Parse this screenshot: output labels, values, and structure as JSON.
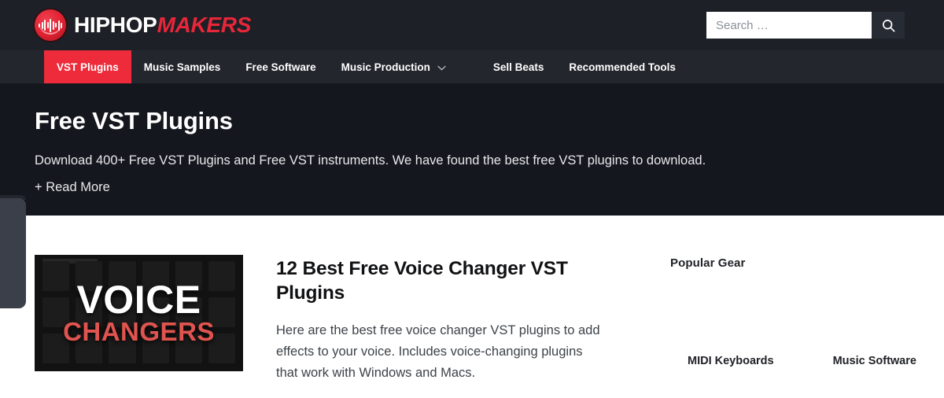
{
  "brand": {
    "name_primary": "HIPHOP",
    "name_secondary": "MAKERS",
    "logo_icon": "waveform-circle-icon",
    "accent_color": "#ed2b3a"
  },
  "search": {
    "placeholder": "Search …",
    "value": "",
    "button_icon": "search-icon"
  },
  "nav": {
    "items": [
      {
        "label": "VST Plugins",
        "active": true,
        "has_dropdown": false
      },
      {
        "label": "Music Samples",
        "active": false,
        "has_dropdown": false
      },
      {
        "label": "Free Software",
        "active": false,
        "has_dropdown": false
      },
      {
        "label": "Music Production",
        "active": false,
        "has_dropdown": true,
        "dropdown_icon": "chevron-down-icon"
      },
      {
        "label": "Sell Beats",
        "active": false,
        "has_dropdown": false
      },
      {
        "label": "Recommended Tools",
        "active": false,
        "has_dropdown": false
      }
    ]
  },
  "hero": {
    "title": "Free VST Plugins",
    "description": "Download 400+ Free VST Plugins and Free VST instruments. We have found the best free VST plugins to download.",
    "read_more": "+ Read More"
  },
  "article": {
    "thumbnail": {
      "line1": "VOICE",
      "line2": "CHANGERS",
      "alt": "voice-changer-plugins-thumbnail"
    },
    "title": "12 Best Free Voice Changer VST Plugins",
    "excerpt": "Here are the best free voice changer VST plugins to add effects to your voice. Includes voice-changing plugins that work with Windows and Macs."
  },
  "sidebar": {
    "title": "Popular Gear",
    "gear_items": [
      {
        "label": "MIDI Keyboards"
      },
      {
        "label": "Music Software"
      }
    ]
  },
  "left_widget": {
    "name": "share-sidebar-tab"
  }
}
